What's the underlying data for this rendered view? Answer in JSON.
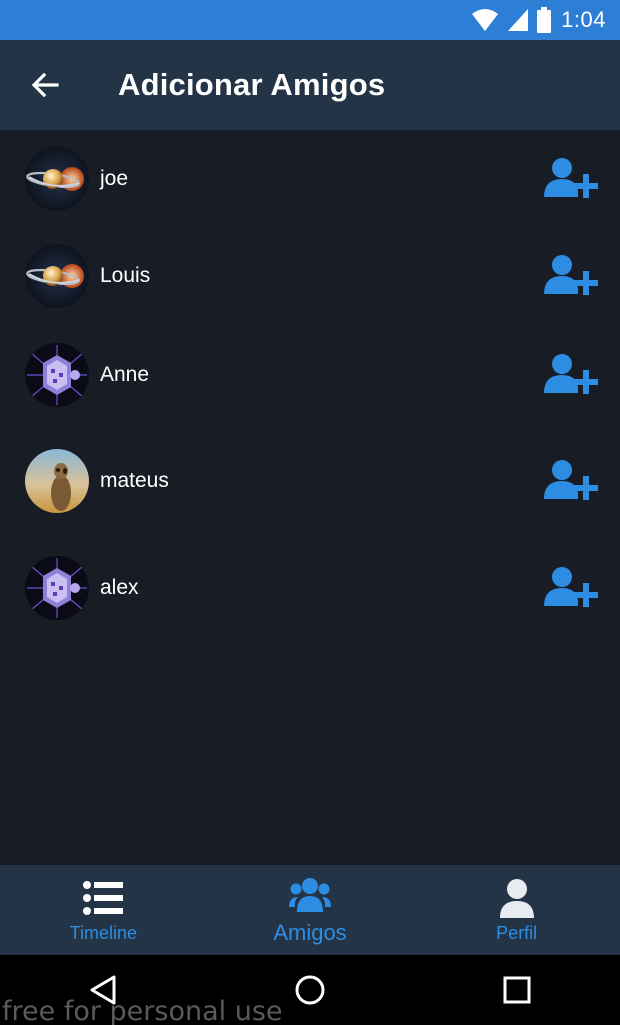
{
  "status_bar": {
    "time": "1:04"
  },
  "app_bar": {
    "title": "Adicionar Amigos",
    "back_icon": "arrow-left-icon"
  },
  "friends": [
    {
      "name": "joe",
      "avatar": "planet-rings-avatar",
      "action_icon": "user-plus-icon"
    },
    {
      "name": "Louis",
      "avatar": "planet-rings-avatar",
      "action_icon": "user-plus-icon"
    },
    {
      "name": "Anne",
      "avatar": "purple-circuit-avatar",
      "action_icon": "user-plus-icon"
    },
    {
      "name": "mateus",
      "avatar": "meerkat-avatar",
      "action_icon": "user-plus-icon"
    },
    {
      "name": "alex",
      "avatar": "purple-circuit-avatar",
      "action_icon": "user-plus-icon"
    }
  ],
  "bottom_nav": {
    "items": [
      {
        "label": "Timeline",
        "icon": "list-icon",
        "active": false
      },
      {
        "label": "Amigos",
        "icon": "group-icon",
        "active": true
      },
      {
        "label": "Perfil",
        "icon": "person-icon",
        "active": false
      }
    ]
  },
  "watermark": "free for personal use",
  "colors": {
    "accent": "#2d8de2",
    "status_bar": "#2d7fd6",
    "app_bar": "#243447",
    "background": "#171c25"
  }
}
